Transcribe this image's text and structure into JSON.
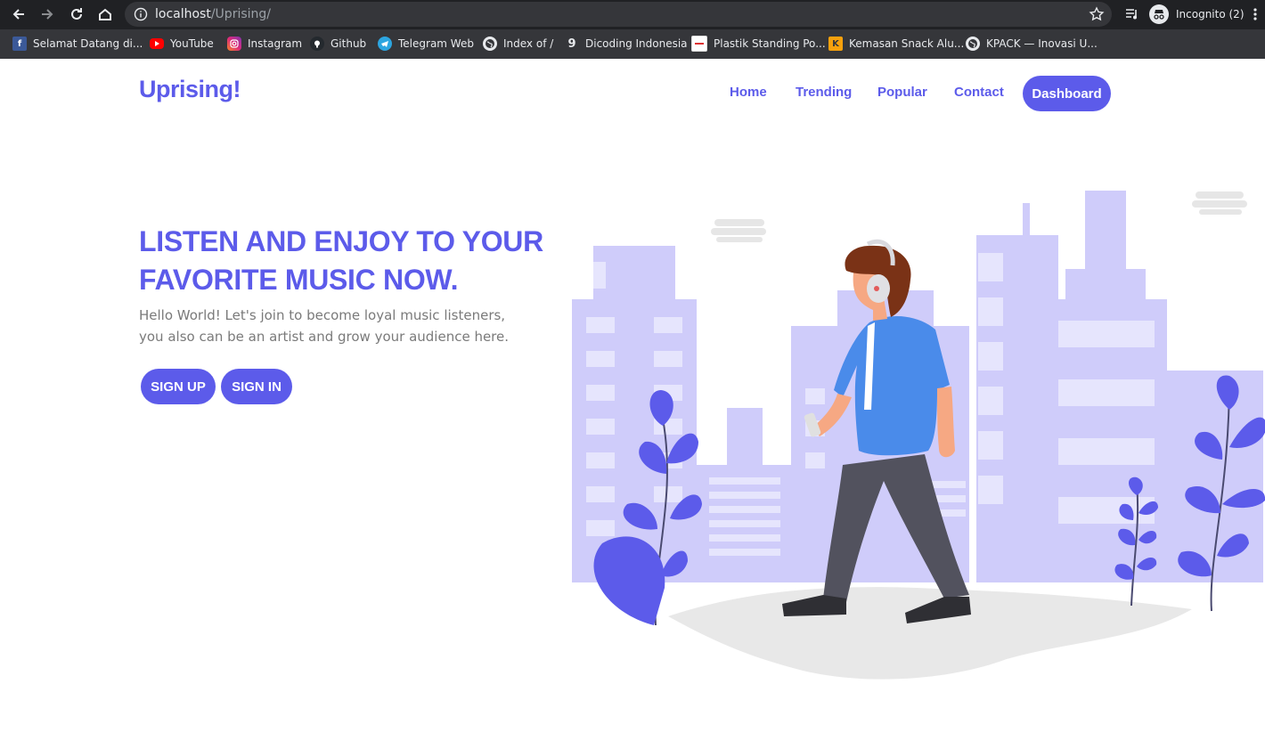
{
  "browser": {
    "url_host": "localhost",
    "url_path": "/Uprising/",
    "profile_label": "Incognito (2)",
    "bookmarks": [
      {
        "label": "Selamat Datang di...",
        "icon": "facebook-icon"
      },
      {
        "label": "YouTube",
        "icon": "youtube-icon"
      },
      {
        "label": "Instagram",
        "icon": "instagram-icon"
      },
      {
        "label": "Github",
        "icon": "github-icon"
      },
      {
        "label": "Telegram Web",
        "icon": "telegram-icon"
      },
      {
        "label": "Index of /",
        "icon": "globe-icon"
      },
      {
        "label": "Dicoding Indonesia",
        "icon": "dicoding-icon"
      },
      {
        "label": "Plastik Standing Po...",
        "icon": "site-icon"
      },
      {
        "label": "Kemasan Snack Alu...",
        "icon": "k-icon"
      },
      {
        "label": "KPACK — Inovasi U...",
        "icon": "globe-icon"
      }
    ]
  },
  "header": {
    "brand": "Uprising!",
    "nav": [
      "Home",
      "Trending",
      "Popular",
      "Contact"
    ],
    "dashboard_label": "Dashboard"
  },
  "hero": {
    "title": "LISTEN AND ENJOY TO YOUR FAVORITE MUSIC NOW.",
    "text": "Hello World! Let's join to become loyal music listeners, you also can be an artist and grow your audience here.",
    "signup_label": "SIGN UP",
    "signin_label": "SIGN IN"
  },
  "colors": {
    "accent": "#5c5bea",
    "city": "#cfccfa",
    "window": "#e6e5fd",
    "leaf": "#5c5bea"
  }
}
